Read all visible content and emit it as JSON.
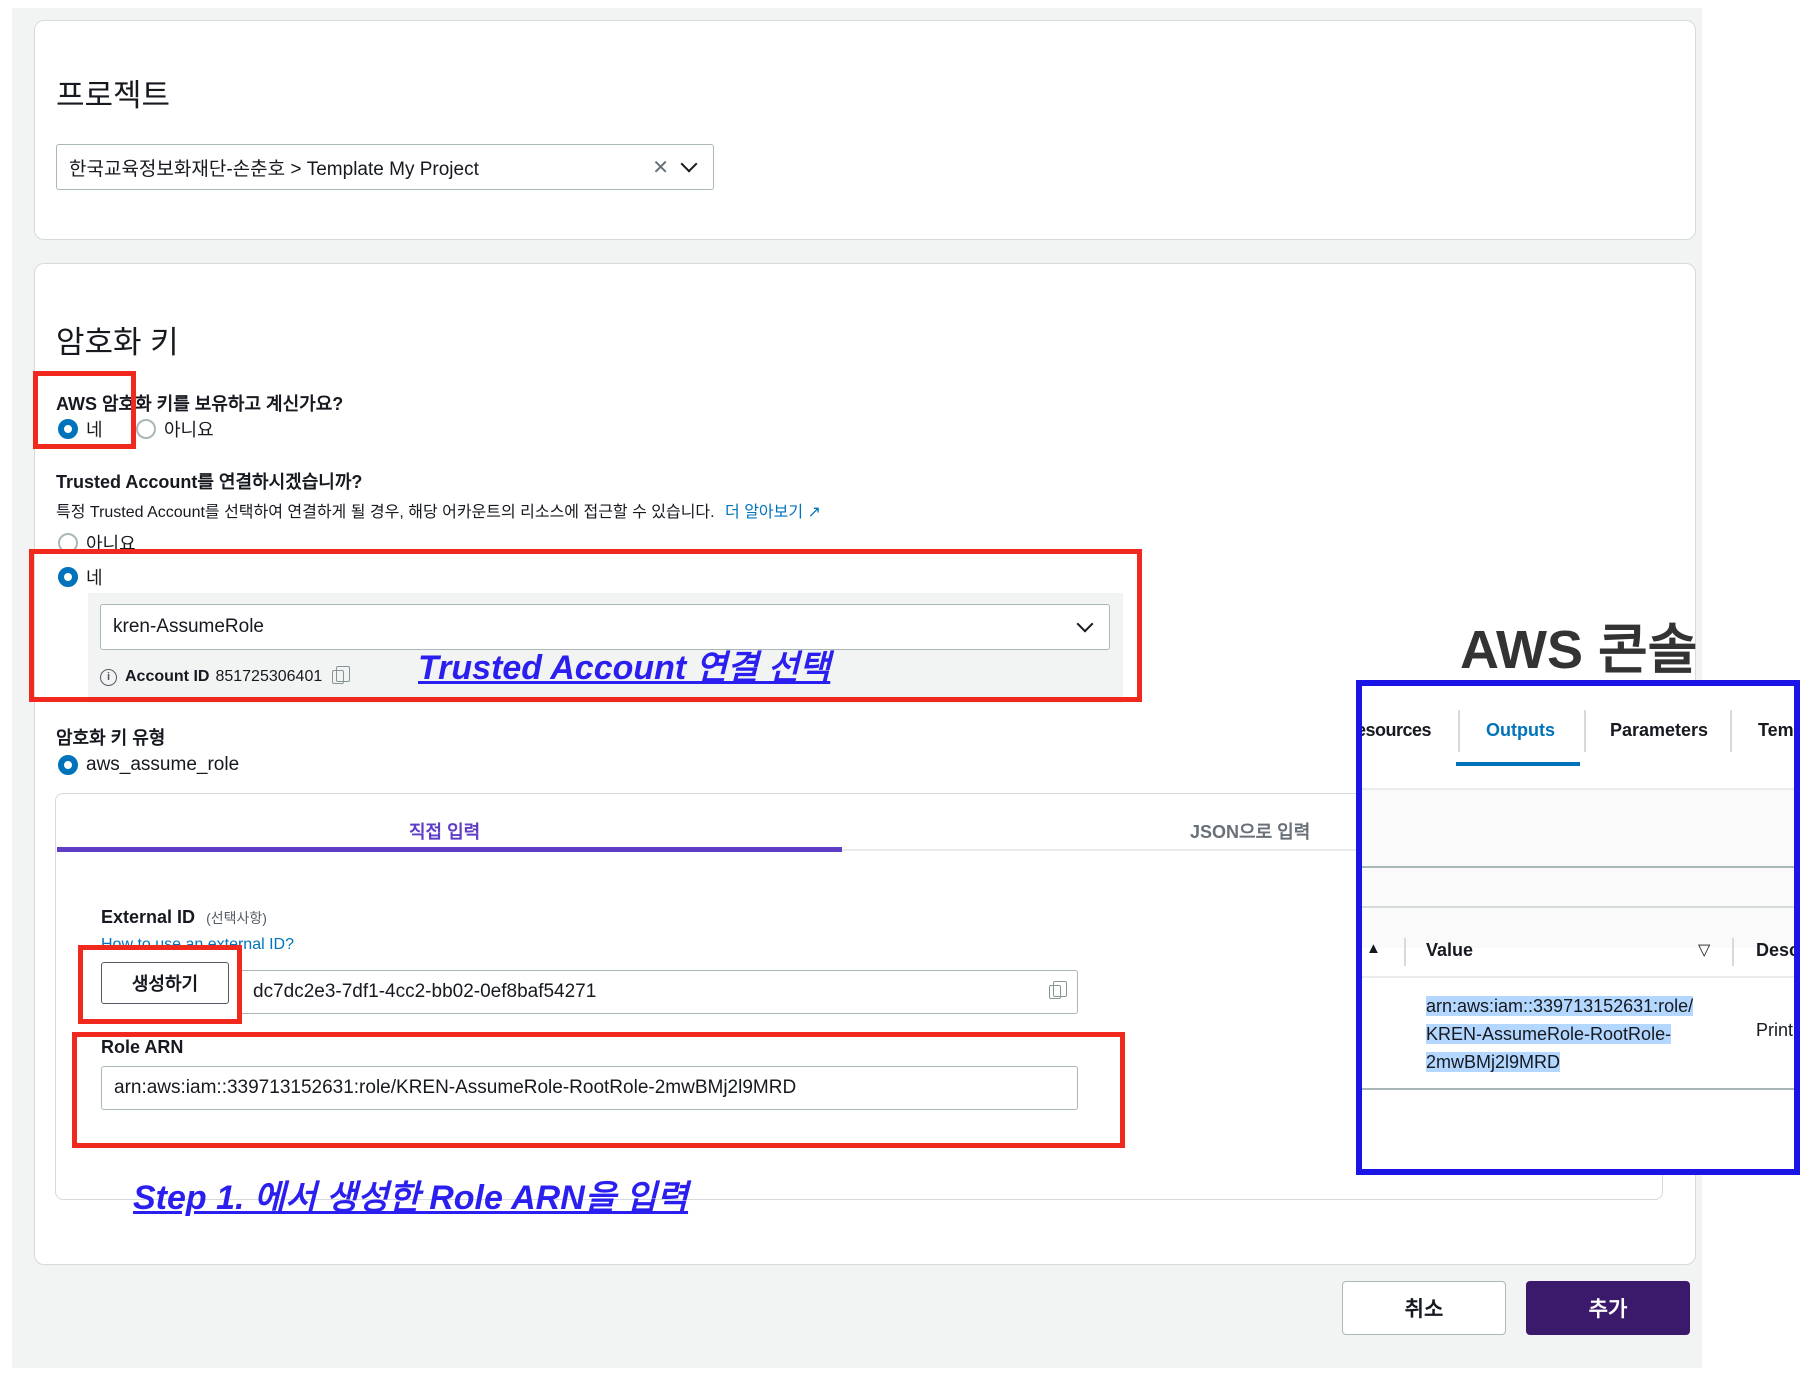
{
  "project": {
    "title": "프로젝트",
    "selected_value": "한국교육정보화재단-손춘호 > Template My Project",
    "clear_icon": "✕"
  },
  "encryption": {
    "title": "암호화 키",
    "own_key_question": "AWS 암호화 키를 보유하고 계신가요?",
    "own_key_yes": "네",
    "own_key_no": "아니요",
    "trusted_question": "Trusted Account를 연결하시겠습니까?",
    "trusted_desc": "특정 Trusted Account를 선택하여 연결하게 될 경우, 해당 어카운트의 리소스에 접근할 수 있습니다.",
    "learn_more": "더 알아보기",
    "trusted_no": "아니요",
    "trusted_yes": "네",
    "trusted_select_value": "kren-AssumeRole",
    "account_id_label": "Account ID",
    "account_id_value": "851725306401",
    "key_type_label": "암호화 키 유형",
    "key_type_value": "aws_assume_role"
  },
  "tabs": {
    "direct": "직접 입력",
    "json": "JSON으로 입력"
  },
  "form": {
    "external_id_label": "External ID",
    "external_id_optional": "(선택사항)",
    "external_id_help": "How to use an external ID?",
    "generate_button": "생성하기",
    "external_id_value": "dc7dc2e3-7df1-4cc2-bb02-0ef8baf54271",
    "role_arn_label": "Role ARN",
    "role_arn_value": "arn:aws:iam::339713152631:role/KREN-AssumeRole-RootRole-2mwBMj2l9MRD"
  },
  "buttons": {
    "cancel": "취소",
    "add": "추가"
  },
  "annotations": {
    "trusted": "Trusted Account 연결 선택",
    "step1": "Step 1. 에서 생성한 Role ARN을 입력",
    "aws_console": "AWS 콘솔"
  },
  "console": {
    "tabs": [
      "esources",
      "Outputs",
      "Parameters",
      "Tem"
    ],
    "active_tab": "Outputs",
    "col_value": "Value",
    "col_desc": "Desc",
    "sort_up": "▲",
    "sort_down": "▽",
    "value_lines": [
      "arn:aws:iam::339713152631:role/",
      "KREN-AssumeRole-RootRole-",
      "2mwBMj2l9MRD"
    ],
    "desc_value": "Print"
  },
  "colors": {
    "primary_purple": "#3b1a6b",
    "tab_purple": "#5f3dc4",
    "link_blue": "#0073bb",
    "annotation_red": "#f0281e",
    "annotation_blue": "#1a14e6"
  }
}
